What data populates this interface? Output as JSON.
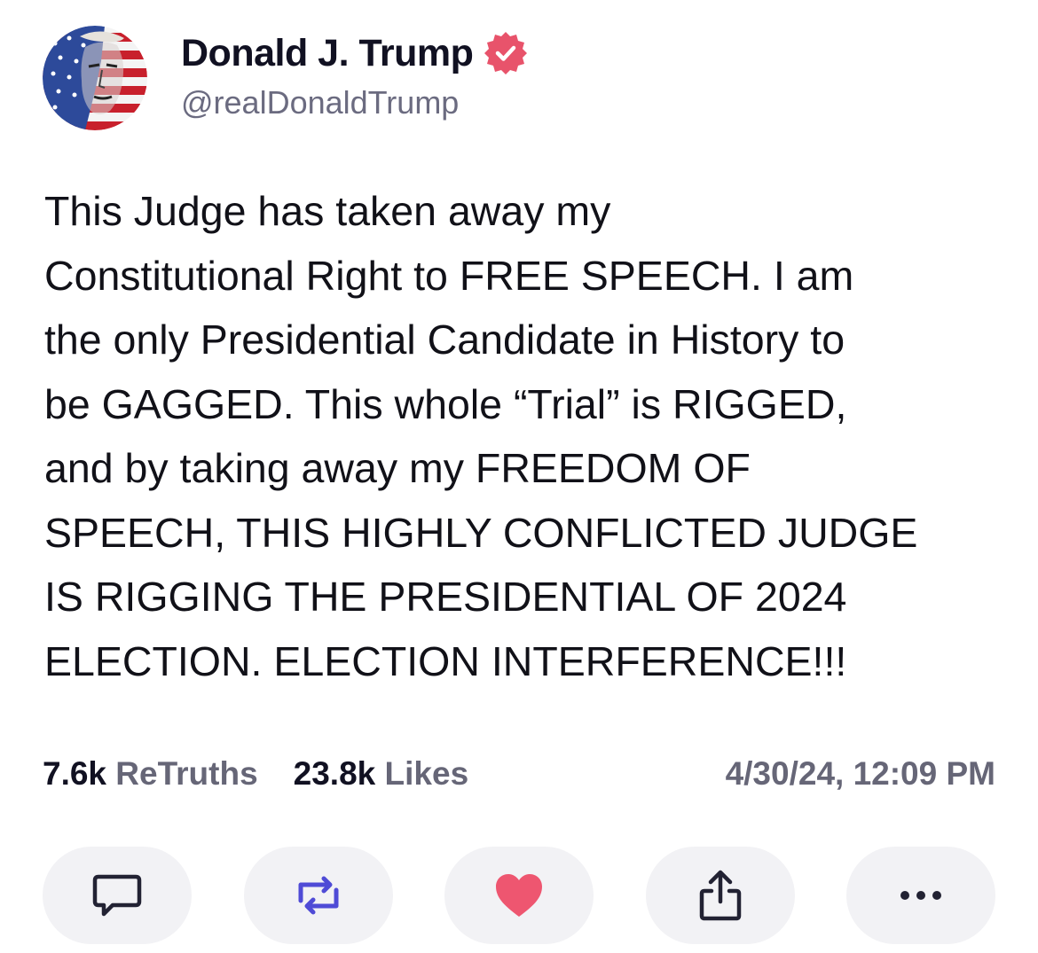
{
  "author": {
    "display_name": "Donald J. Trump",
    "handle": "@realDonaldTrump",
    "verified": true,
    "avatar_icon": "flag-portrait-avatar"
  },
  "post": {
    "text": "This Judge has taken away my\nConstitutional Right to FREE SPEECH. I am\nthe only Presidential Candidate in History to\nbe GAGGED. This whole “Trial” is RIGGED,\nand by taking away my FREEDOM OF\nSPEECH, THIS HIGHLY CONFLICTED JUDGE\nIS RIGGING THE PRESIDENTIAL OF 2024\nELECTION. ELECTION INTERFERENCE!!!"
  },
  "stats": {
    "retruths_count": "7.6k",
    "retruths_label": "ReTruths",
    "likes_count": "23.8k",
    "likes_label": "Likes",
    "timestamp": "4/30/24, 12:09 PM"
  },
  "actions": [
    {
      "name": "reply",
      "icon": "speech-bubble-icon"
    },
    {
      "name": "retruth",
      "icon": "retruth-arrows-icon"
    },
    {
      "name": "like",
      "icon": "heart-icon"
    },
    {
      "name": "share",
      "icon": "share-icon"
    },
    {
      "name": "more",
      "icon": "ellipsis-icon"
    }
  ],
  "colors": {
    "verified_badge": "#e8536b",
    "like_heart": "#ee5670",
    "retruth_arrows": "#4f4bd6",
    "icon_dark": "#222233",
    "button_bg": "#f2f2f5",
    "secondary_text": "#666677"
  }
}
